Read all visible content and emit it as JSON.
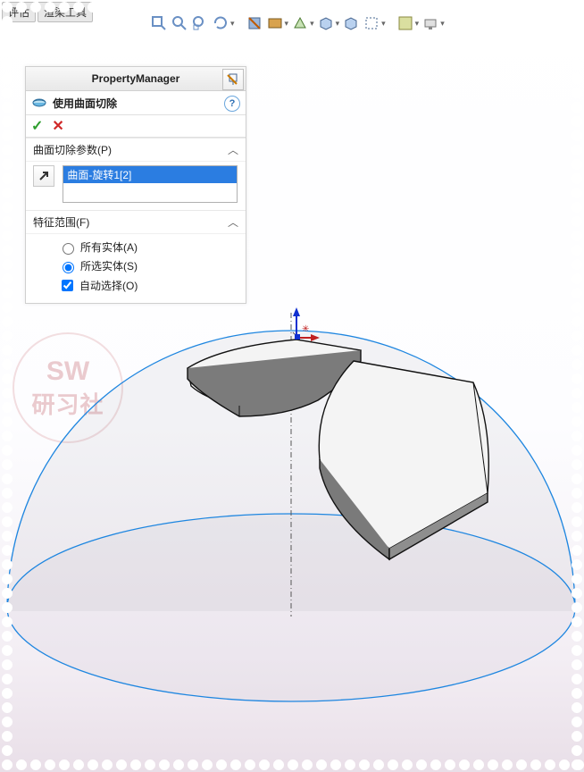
{
  "tabs": {
    "evaluate": "评估",
    "render_tools": "渲染工具"
  },
  "topbar_icons": [
    "zoom-to-fit-icon",
    "magnifier-icon",
    "magnifier-area-icon",
    "rotate-view-icon",
    "section-view-icon",
    "shaded-edges-icon",
    "shaded-icon",
    "box-icon",
    "hidden-lines-icon",
    "wireframe-icon",
    "perspective-icon",
    "light-icon",
    "monitor-icon"
  ],
  "pm_header": "PropertyManager",
  "feature_name": "使用曲面切除",
  "help_symbol": "?",
  "buttons": {
    "ok": "✓",
    "cancel": "✕"
  },
  "section_params_title": "曲面切除参数(P)",
  "selection_items": [
    "曲面-旋转1[2]"
  ],
  "section_scope_title": "特征范围(F)",
  "scope": {
    "all_bodies": "所有实体(A)",
    "selected_bodies": "所选实体(S)",
    "auto_select": "自动选择(O)",
    "value": "selected",
    "auto_checked": true
  },
  "watermark": {
    "line1": "SW",
    "line2": "研习社"
  }
}
